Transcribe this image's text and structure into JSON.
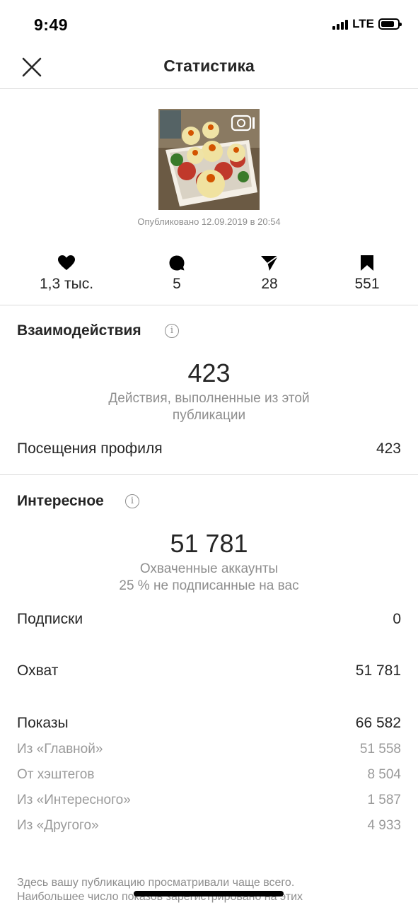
{
  "status_bar": {
    "time": "9:49",
    "network": "LTE",
    "battery_level": 0.8
  },
  "header": {
    "title": "Статистика",
    "close_icon": "close-icon"
  },
  "post": {
    "published": "Опубликовано 12.09.2019 в 20:54",
    "media_type_icon": "igtv-icon"
  },
  "metrics": [
    {
      "icon": "heart-icon",
      "value": "1,3 тыс."
    },
    {
      "icon": "comment-icon",
      "value": "5"
    },
    {
      "icon": "share-icon",
      "value": "28"
    },
    {
      "icon": "bookmark-icon",
      "value": "551"
    }
  ],
  "interactions": {
    "title": "Взаимодействия",
    "info_icon": "info-icon",
    "total": "423",
    "caption_line1": "Действия, выполненные из этой",
    "caption_line2": "публикации",
    "rows": [
      {
        "label": "Посещения профиля",
        "value": "423"
      }
    ]
  },
  "discovery": {
    "title": "Интересное",
    "info_icon": "info-icon",
    "total": "51 781",
    "caption_line1": "Охваченные аккаунты",
    "caption_line2": "25 % не подписанные на вас",
    "follows": {
      "label": "Подписки",
      "value": "0"
    },
    "reach": {
      "label": "Охват",
      "value": "51 781"
    },
    "impressions": {
      "label": "Показы",
      "value": "66 582"
    },
    "impression_sources": [
      {
        "label": "Из «Главной»",
        "value": "51 558"
      },
      {
        "label": "От хэштегов",
        "value": "8 504"
      },
      {
        "label": "Из «Интересного»",
        "value": "1 587"
      },
      {
        "label": "Из «Другого»",
        "value": "4 933"
      }
    ]
  },
  "footer": {
    "line1": "Здесь вашу публикацию просматривали чаще всего.",
    "line2": "Наибольшее число показов зарегистрировано на этих"
  },
  "colors": {
    "text": "#262626",
    "secondary": "#8e8e8e",
    "divider": "#dbdbdb"
  }
}
